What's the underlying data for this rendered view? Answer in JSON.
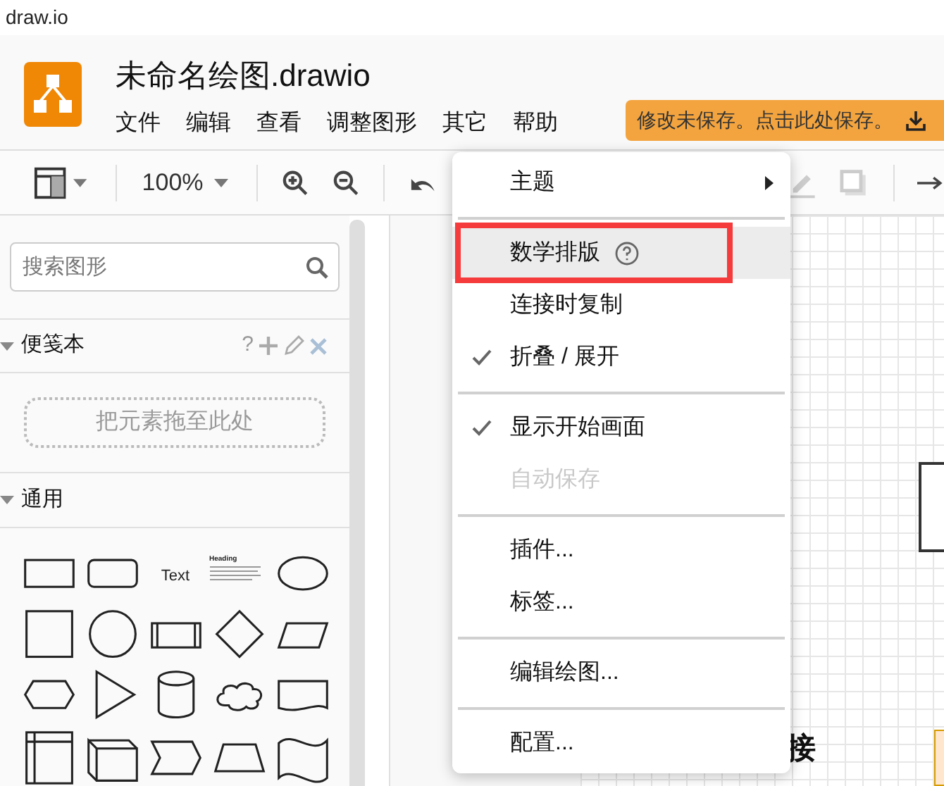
{
  "browser_tab": {
    "title": "draw.io"
  },
  "header": {
    "file_title": "未命名绘图.drawio",
    "menus": [
      "文件",
      "编辑",
      "查看",
      "调整图形",
      "其它",
      "帮助"
    ],
    "save_notice": "修改未保存。点击此处保存。"
  },
  "toolbar": {
    "zoom": "100%"
  },
  "sidebar": {
    "search": {
      "placeholder": "搜索图形"
    },
    "sections": [
      {
        "title": "便笺本",
        "expanded": true,
        "help": "?",
        "drop_hint": "把元素拖至此处"
      },
      {
        "title": "通用",
        "expanded": true
      }
    ],
    "shapes": [
      {
        "kind": "rect"
      },
      {
        "kind": "rounded"
      },
      {
        "kind": "text",
        "label": "Text"
      },
      {
        "kind": "heading",
        "label": "Heading"
      },
      {
        "kind": "ellipse"
      },
      {
        "kind": "square"
      },
      {
        "kind": "circle"
      },
      {
        "kind": "process"
      },
      {
        "kind": "diamond"
      },
      {
        "kind": "parallelogram"
      },
      {
        "kind": "hexagon"
      },
      {
        "kind": "triangle"
      },
      {
        "kind": "cylinder"
      },
      {
        "kind": "cloud"
      },
      {
        "kind": "document"
      },
      {
        "kind": "internal"
      },
      {
        "kind": "cube"
      },
      {
        "kind": "step"
      },
      {
        "kind": "trapezoid"
      },
      {
        "kind": "tape"
      }
    ]
  },
  "canvas": {
    "label": "接"
  },
  "menu": {
    "items": [
      {
        "kind": "item",
        "label": "主题",
        "submenu": true,
        "checked": false,
        "disabled": false,
        "selected": false,
        "outlined": false
      },
      {
        "kind": "separator"
      },
      {
        "kind": "item",
        "label": "数学排版",
        "help": true,
        "checked": false,
        "disabled": false,
        "selected": true,
        "outlined": true
      },
      {
        "kind": "item",
        "label": "连接时复制",
        "checked": false,
        "disabled": false,
        "selected": false,
        "outlined": false
      },
      {
        "kind": "item",
        "label": "折叠 / 展开",
        "checked": true,
        "disabled": false,
        "selected": false,
        "outlined": false
      },
      {
        "kind": "separator"
      },
      {
        "kind": "item",
        "label": "显示开始画面",
        "checked": true,
        "disabled": false,
        "selected": false,
        "outlined": false
      },
      {
        "kind": "item",
        "label": "自动保存",
        "checked": false,
        "disabled": true,
        "selected": false,
        "outlined": false
      },
      {
        "kind": "separator"
      },
      {
        "kind": "item",
        "label": "插件...",
        "checked": false,
        "disabled": false,
        "selected": false,
        "outlined": false
      },
      {
        "kind": "item",
        "label": "标签...",
        "checked": false,
        "disabled": false,
        "selected": false,
        "outlined": false
      },
      {
        "kind": "separator"
      },
      {
        "kind": "item",
        "label": "编辑绘图...",
        "checked": false,
        "disabled": false,
        "selected": false,
        "outlined": false
      },
      {
        "kind": "separator"
      },
      {
        "kind": "item",
        "label": "配置...",
        "checked": false,
        "disabled": false,
        "selected": false,
        "outlined": false
      }
    ]
  }
}
